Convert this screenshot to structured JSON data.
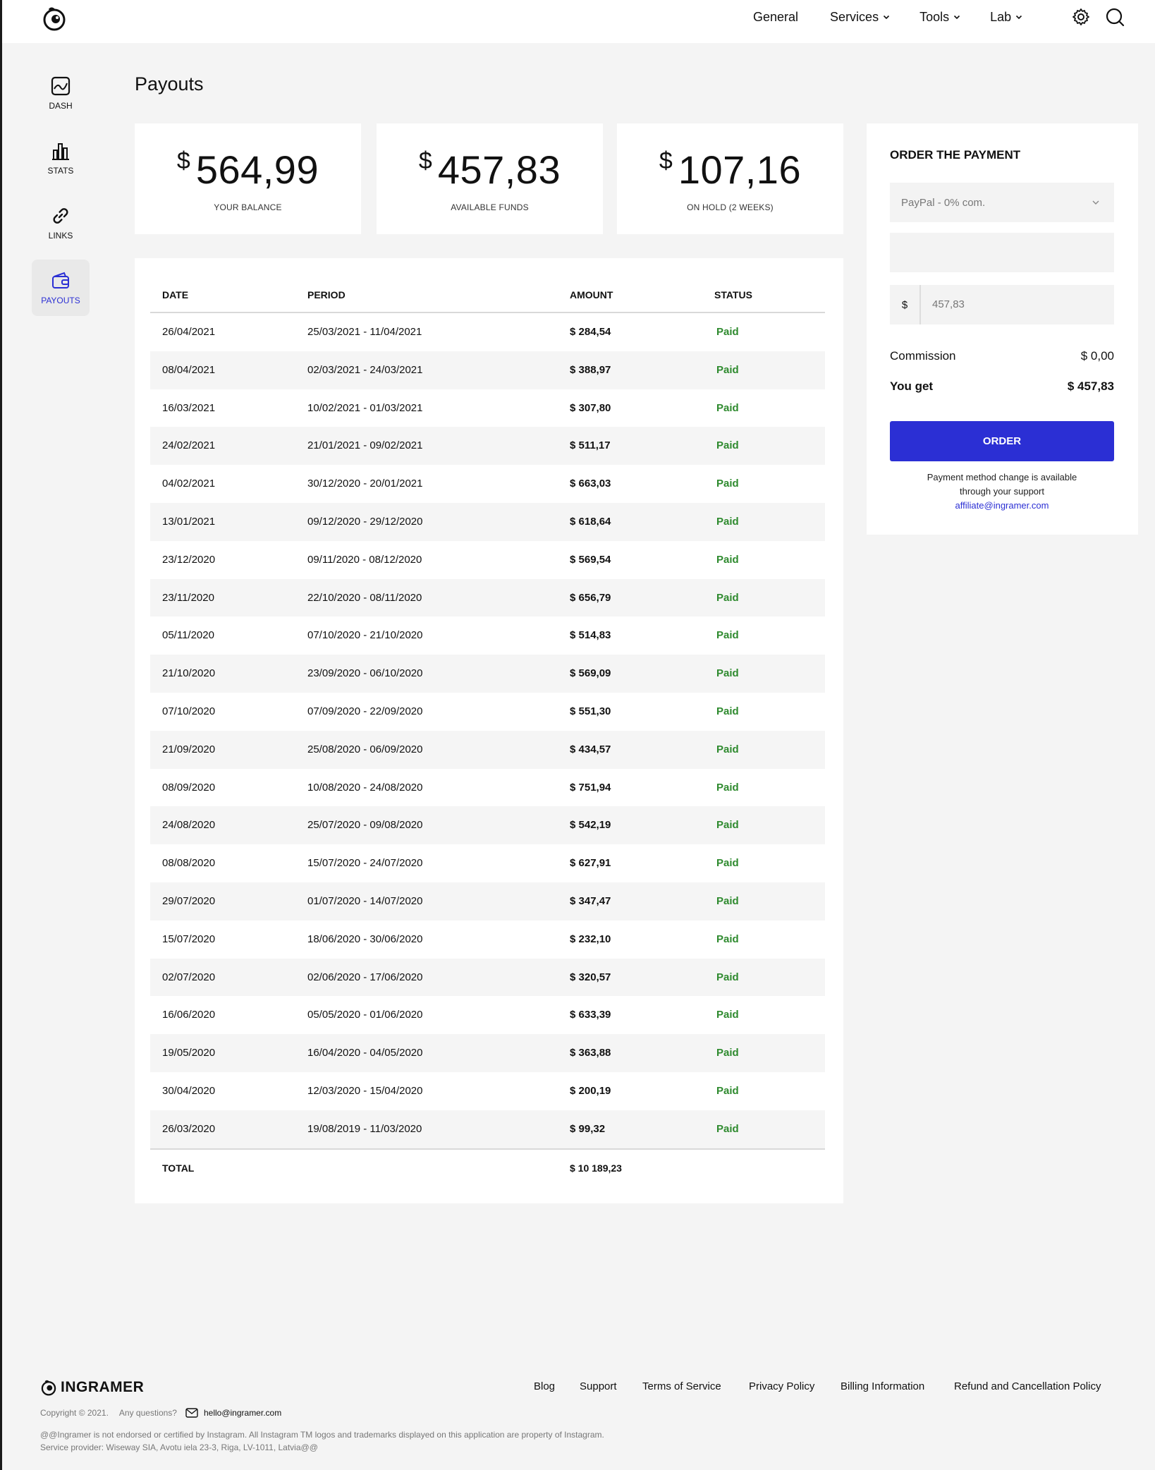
{
  "nav": {
    "items": [
      {
        "label": "General",
        "has_dropdown": false
      },
      {
        "label": "Services",
        "has_dropdown": true
      },
      {
        "label": "Tools",
        "has_dropdown": true
      },
      {
        "label": "Lab",
        "has_dropdown": true
      }
    ]
  },
  "sidebar": {
    "items": [
      {
        "label": "DASH",
        "icon": "dashboard-icon"
      },
      {
        "label": "STATS",
        "icon": "stats-icon"
      },
      {
        "label": "LINKS",
        "icon": "link-icon"
      },
      {
        "label": "PAYOUTS",
        "icon": "wallet-icon",
        "active": true
      }
    ]
  },
  "page": {
    "title": "Payouts"
  },
  "stats": [
    {
      "currency": "$",
      "value": "564,99",
      "label": "YOUR BALANCE"
    },
    {
      "currency": "$",
      "value": "457,83",
      "label": "AVAILABLE FUNDS"
    },
    {
      "currency": "$",
      "value": "107,16",
      "label": "ON HOLD (2 WEEKS)"
    }
  ],
  "table": {
    "headers": {
      "date": "DATE",
      "period": "PERIOD",
      "amount": "AMOUNT",
      "status": "STATUS"
    },
    "rows": [
      {
        "date": "26/04/2021",
        "period": "25/03/2021 - 11/04/2021",
        "amount": "$ 284,54",
        "status": "Paid"
      },
      {
        "date": "08/04/2021",
        "period": "02/03/2021 - 24/03/2021",
        "amount": "$ 388,97",
        "status": "Paid"
      },
      {
        "date": "16/03/2021",
        "period": "10/02/2021 - 01/03/2021",
        "amount": "$ 307,80",
        "status": "Paid"
      },
      {
        "date": "24/02/2021",
        "period": "21/01/2021 - 09/02/2021",
        "amount": "$ 511,17",
        "status": "Paid"
      },
      {
        "date": "04/02/2021",
        "period": "30/12/2020 - 20/01/2021",
        "amount": "$ 663,03",
        "status": "Paid"
      },
      {
        "date": "13/01/2021",
        "period": "09/12/2020 - 29/12/2020",
        "amount": "$ 618,64",
        "status": "Paid"
      },
      {
        "date": "23/12/2020",
        "period": "09/11/2020 - 08/12/2020",
        "amount": "$ 569,54",
        "status": "Paid"
      },
      {
        "date": "23/11/2020",
        "period": "22/10/2020 - 08/11/2020",
        "amount": "$ 656,79",
        "status": "Paid"
      },
      {
        "date": "05/11/2020",
        "period": "07/10/2020 - 21/10/2020",
        "amount": "$ 514,83",
        "status": "Paid"
      },
      {
        "date": "21/10/2020",
        "period": "23/09/2020 - 06/10/2020",
        "amount": "$ 569,09",
        "status": "Paid"
      },
      {
        "date": "07/10/2020",
        "period": "07/09/2020 - 22/09/2020",
        "amount": "$ 551,30",
        "status": "Paid"
      },
      {
        "date": "21/09/2020",
        "period": "25/08/2020 - 06/09/2020",
        "amount": "$ 434,57",
        "status": "Paid"
      },
      {
        "date": "08/09/2020",
        "period": "10/08/2020 - 24/08/2020",
        "amount": "$ 751,94",
        "status": "Paid"
      },
      {
        "date": "24/08/2020",
        "period": "25/07/2020 - 09/08/2020",
        "amount": "$ 542,19",
        "status": "Paid"
      },
      {
        "date": "08/08/2020",
        "period": "15/07/2020 - 24/07/2020",
        "amount": "$ 627,91",
        "status": "Paid"
      },
      {
        "date": "29/07/2020",
        "period": "01/07/2020 - 14/07/2020",
        "amount": "$ 347,47",
        "status": "Paid"
      },
      {
        "date": "15/07/2020",
        "period": "18/06/2020 - 30/06/2020",
        "amount": "$ 232,10",
        "status": "Paid"
      },
      {
        "date": "02/07/2020",
        "period": "02/06/2020 - 17/06/2020",
        "amount": "$ 320,57",
        "status": "Paid"
      },
      {
        "date": "16/06/2020",
        "period": "05/05/2020 - 01/06/2020",
        "amount": "$ 633,39",
        "status": "Paid"
      },
      {
        "date": "19/05/2020",
        "period": "16/04/2020 - 04/05/2020",
        "amount": "$ 363,88",
        "status": "Paid"
      },
      {
        "date": "30/04/2020",
        "period": "12/03/2020 - 15/04/2020",
        "amount": "$ 200,19",
        "status": "Paid"
      },
      {
        "date": "26/03/2020",
        "period": "19/08/2019 - 11/03/2020",
        "amount": "$ 99,32",
        "status": "Paid"
      }
    ],
    "total": {
      "label": "TOTAL",
      "amount": "$ 10 189,23"
    }
  },
  "order": {
    "title": "ORDER THE PAYMENT",
    "method": "PayPal - 0% com.",
    "currency_prefix": "$",
    "amount_placeholder": "457,83",
    "commission_label": "Commission",
    "commission_value": "$ 0,00",
    "you_get_label": "You get",
    "you_get_value": "$ 457,83",
    "button_label": "ORDER",
    "note_line1": "Payment method change is available",
    "note_line2": "through your support",
    "support_email": "affiliate@ingramer.com"
  },
  "footer": {
    "brand": "INGRAMER",
    "links": [
      "Blog",
      "Support",
      "Terms of Service",
      "Privacy Policy",
      "Billing Information",
      "Refund and Cancellation Policy"
    ],
    "copyright": "Copyright © 2021.",
    "questions": "Any questions?",
    "email": "hello@ingramer.com",
    "legal_line1": "@@Ingramer is not endorsed or certified by Instagram. All Instagram TM logos and trademarks displayed on this application are property of Instagram.",
    "legal_line2": "Service provider: Wiseway SIA, Avotu iela 23-3, Riga, LV-1011, Latvia@@"
  },
  "colors": {
    "accent": "#2b2fd4",
    "paid": "#2e8a2e",
    "background": "#f4f4f4"
  }
}
